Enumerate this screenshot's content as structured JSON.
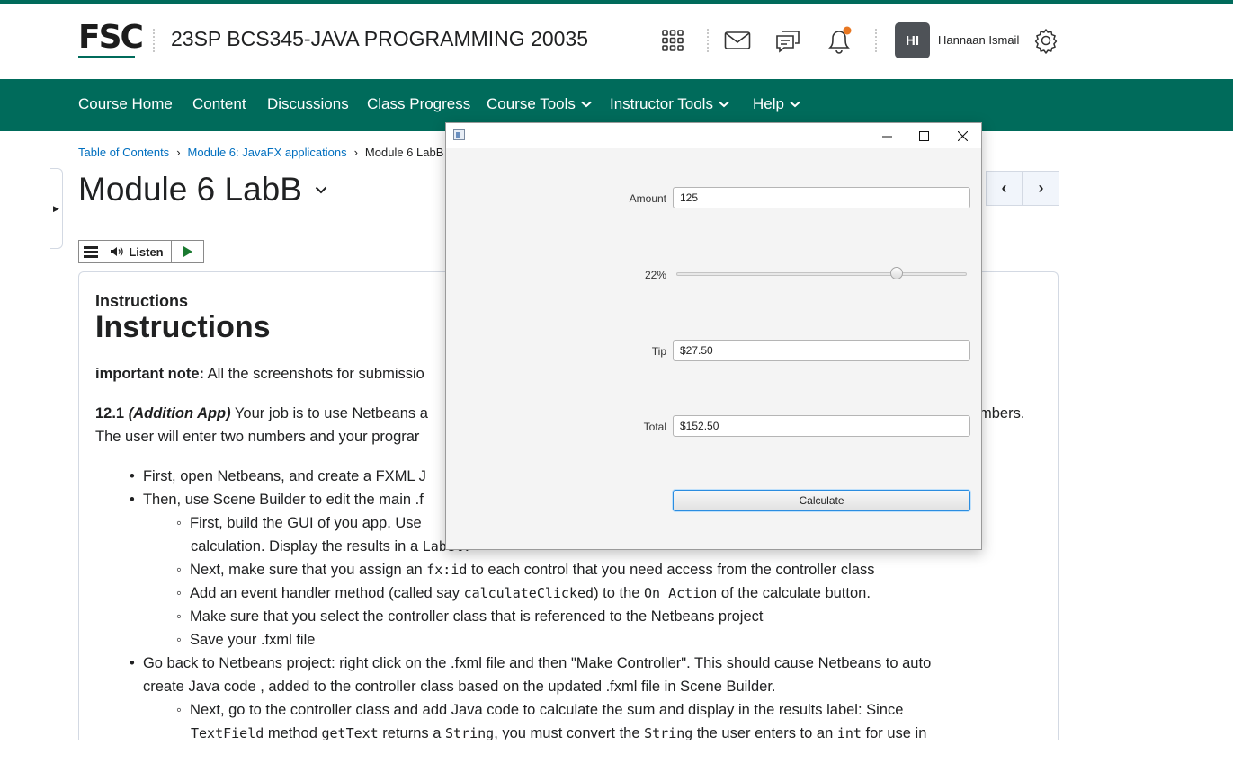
{
  "header": {
    "logo": "FSC",
    "course_title": "23SP BCS345-JAVA PROGRAMMING 20035",
    "icons": [
      "apps-grid-icon",
      "mail-icon",
      "chat-icon",
      "bell-icon",
      "gear-icon"
    ],
    "avatar_initials": "HI",
    "user_name": "Hannaan Ismail",
    "notification_dot_color": "#e87722"
  },
  "nav": {
    "items": [
      "Course Home",
      "Content",
      "Discussions",
      "Class Progress",
      "Course Tools",
      "Instructor Tools",
      "Help"
    ],
    "bg_color": "#006b5b"
  },
  "breadcrumb": {
    "items": [
      "Table of Contents",
      "Module 6: JavaFX applications",
      "Module 6 LabB"
    ]
  },
  "page": {
    "title": "Module 6 LabB",
    "listen_label": "Listen"
  },
  "content": {
    "small_heading": "Instructions",
    "big_heading": "Instructions",
    "note_bold": "important note:",
    "note_text": " All the screenshots for submissio",
    "p121_num": "12.1 ",
    "p121_italic": "(Addition App)",
    "p121_text": " Your job is to use Netbeans a",
    "p121_tail": "mbers.",
    "p121_line2": "The user will enter two numbers and your prograr",
    "b1": "First, open Netbeans, and create a FXML J",
    "b2": "Then, use Scene Builder to edit the main .f",
    "b2_1": "First, build the GUI of you app.  Use",
    "b2_1_cont_text": "calculation. Display the results in a ",
    "b2_1_cont_code": "Label.",
    "b2_2_a": "Next, make sure that you assign an ",
    "b2_2_code": "fx:id",
    "b2_2_b": " to each control that you need access from the controller class",
    "b2_3_a": "Add an event handler method (called say ",
    "b2_3_code": "calculateClicked",
    "b2_3_b": ") to the ",
    "b2_3_code2": "On Action",
    "b2_3_c": " of the calculate button.",
    "b2_4": "Make sure that you select the controller class that is referenced to the Netbeans project",
    "b2_5": "Save your .fxml file",
    "b3": "Go back to Netbeans project: right click on the .fxml file and then \"Make Controller\". This should cause Netbeans to auto",
    "b3_cont": "create Java code , added to the controller class based on the updated .fxml file in Scene Builder.",
    "b3_1": "Next, go to the controller class and add Java code to calculate the sum and display in the results label: Since",
    "b3_1_c1": "TextField",
    "b3_1_t1": " method ",
    "b3_1_c2": "getText",
    "b3_1_t2": " returns a ",
    "b3_1_c3": "String",
    "b3_1_t3": ", you must convert the ",
    "b3_1_c4": "String",
    "b3_1_t4": " the user enters to an ",
    "b3_1_c5": "int",
    "b3_1_t5": " for use in"
  },
  "fxapp": {
    "amount_label": "Amount",
    "amount_value": "125",
    "percent_label": "22%",
    "tip_percent": 22,
    "tip_label": "Tip",
    "tip_value": "$27.50",
    "total_label": "Total",
    "total_value": "$152.50",
    "calculate_label": "Calculate",
    "controls": [
      "minimize-icon",
      "maximize-icon",
      "close-icon"
    ]
  }
}
